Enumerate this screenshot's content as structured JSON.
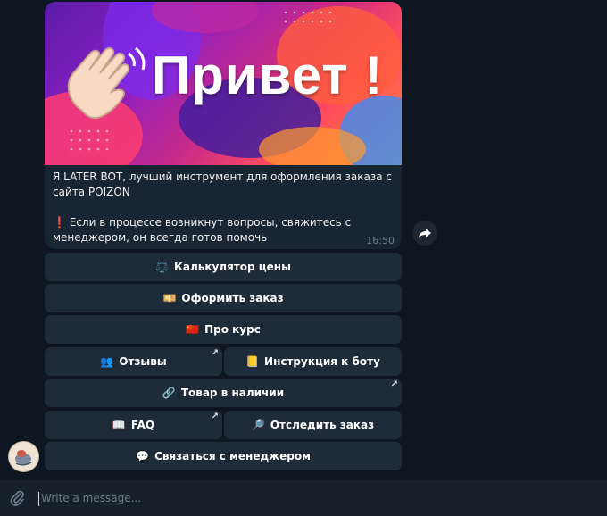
{
  "message": {
    "banner_text": "Привет !",
    "text": "Я LATER BOT, лучший инструмент для оформления заказа с сайта POIZON\n\n❗ Если в процессе возникнут вопросы, свяжитесь с менеджером, он всегда готов помочь",
    "time": "16:50"
  },
  "keyboard": {
    "calc": {
      "emoji": "⚖️",
      "label": "Калькулятор цены"
    },
    "order": {
      "emoji": "💴",
      "label": "Оформить заказ"
    },
    "course": {
      "emoji": "🇨🇳",
      "label": "Про курс"
    },
    "reviews": {
      "emoji": "👥",
      "label": "Отзывы",
      "arrow": "↗"
    },
    "instruction": {
      "emoji": "📒",
      "label": "Инструкция к боту"
    },
    "stock": {
      "emoji": "🔗",
      "label": "Товар в наличии",
      "arrow": "↗"
    },
    "faq": {
      "emoji": "📖",
      "label": "FAQ",
      "arrow": "↗"
    },
    "track": {
      "emoji": "🔎",
      "label": "Отследить заказ"
    },
    "contact": {
      "emoji": "💬",
      "label": "Связаться с менеджером"
    }
  },
  "input": {
    "placeholder": "Write a message..."
  }
}
